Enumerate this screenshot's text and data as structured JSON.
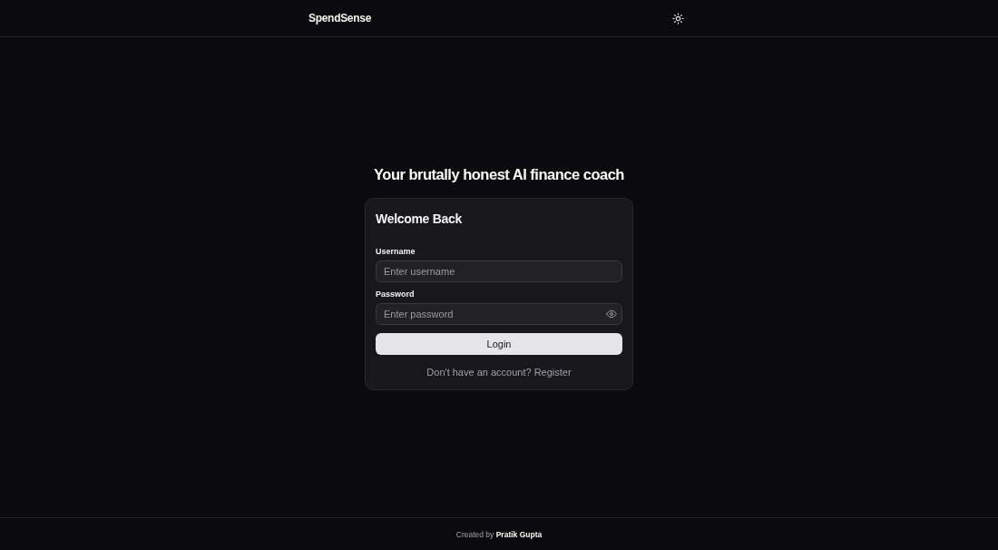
{
  "header": {
    "brand": "SpendSense"
  },
  "tagline": "Your brutally honest AI finance coach",
  "login_card": {
    "title": "Welcome Back",
    "fields": [
      {
        "kind": "text",
        "label": "Username",
        "placeholder": "Enter username"
      },
      {
        "kind": "password",
        "label": "Password",
        "placeholder": "Enter password"
      }
    ],
    "submit": "Login",
    "register_prompt": {
      "text": "Don't have an account?",
      "link": "Register"
    }
  },
  "footer": {
    "credit": "Created by **Pratik Gupta**"
  }
}
